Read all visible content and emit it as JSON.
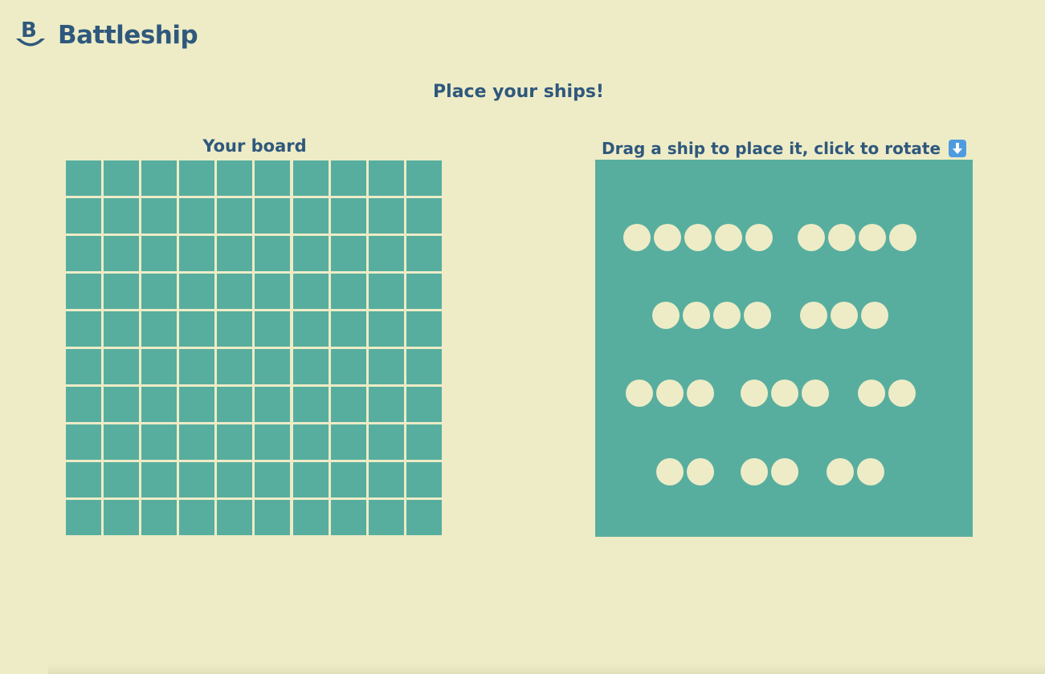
{
  "header": {
    "title": "Battleship",
    "logo_icon": "battleship-logo-icon",
    "brand_color": "#2f587d"
  },
  "page": {
    "heading": "Place your ships!"
  },
  "board": {
    "title": "Your board",
    "rows": 10,
    "columns": 10,
    "cell_color": "#57ae9f"
  },
  "dock": {
    "instructions": "Drag a ship to place it, click to rotate",
    "rotate_icon": "down-arrow-icon",
    "background_color": "#57ae9f",
    "ships": [
      {
        "size": 5
      },
      {
        "size": 4
      },
      {
        "size": 4
      },
      {
        "size": 3
      },
      {
        "size": 3
      },
      {
        "size": 3
      },
      {
        "size": 2
      },
      {
        "size": 2
      },
      {
        "size": 2
      },
      {
        "size": 2
      }
    ]
  },
  "colors": {
    "background": "#eeecc6",
    "text": "#2f587d",
    "peg": "#eeecc6"
  }
}
